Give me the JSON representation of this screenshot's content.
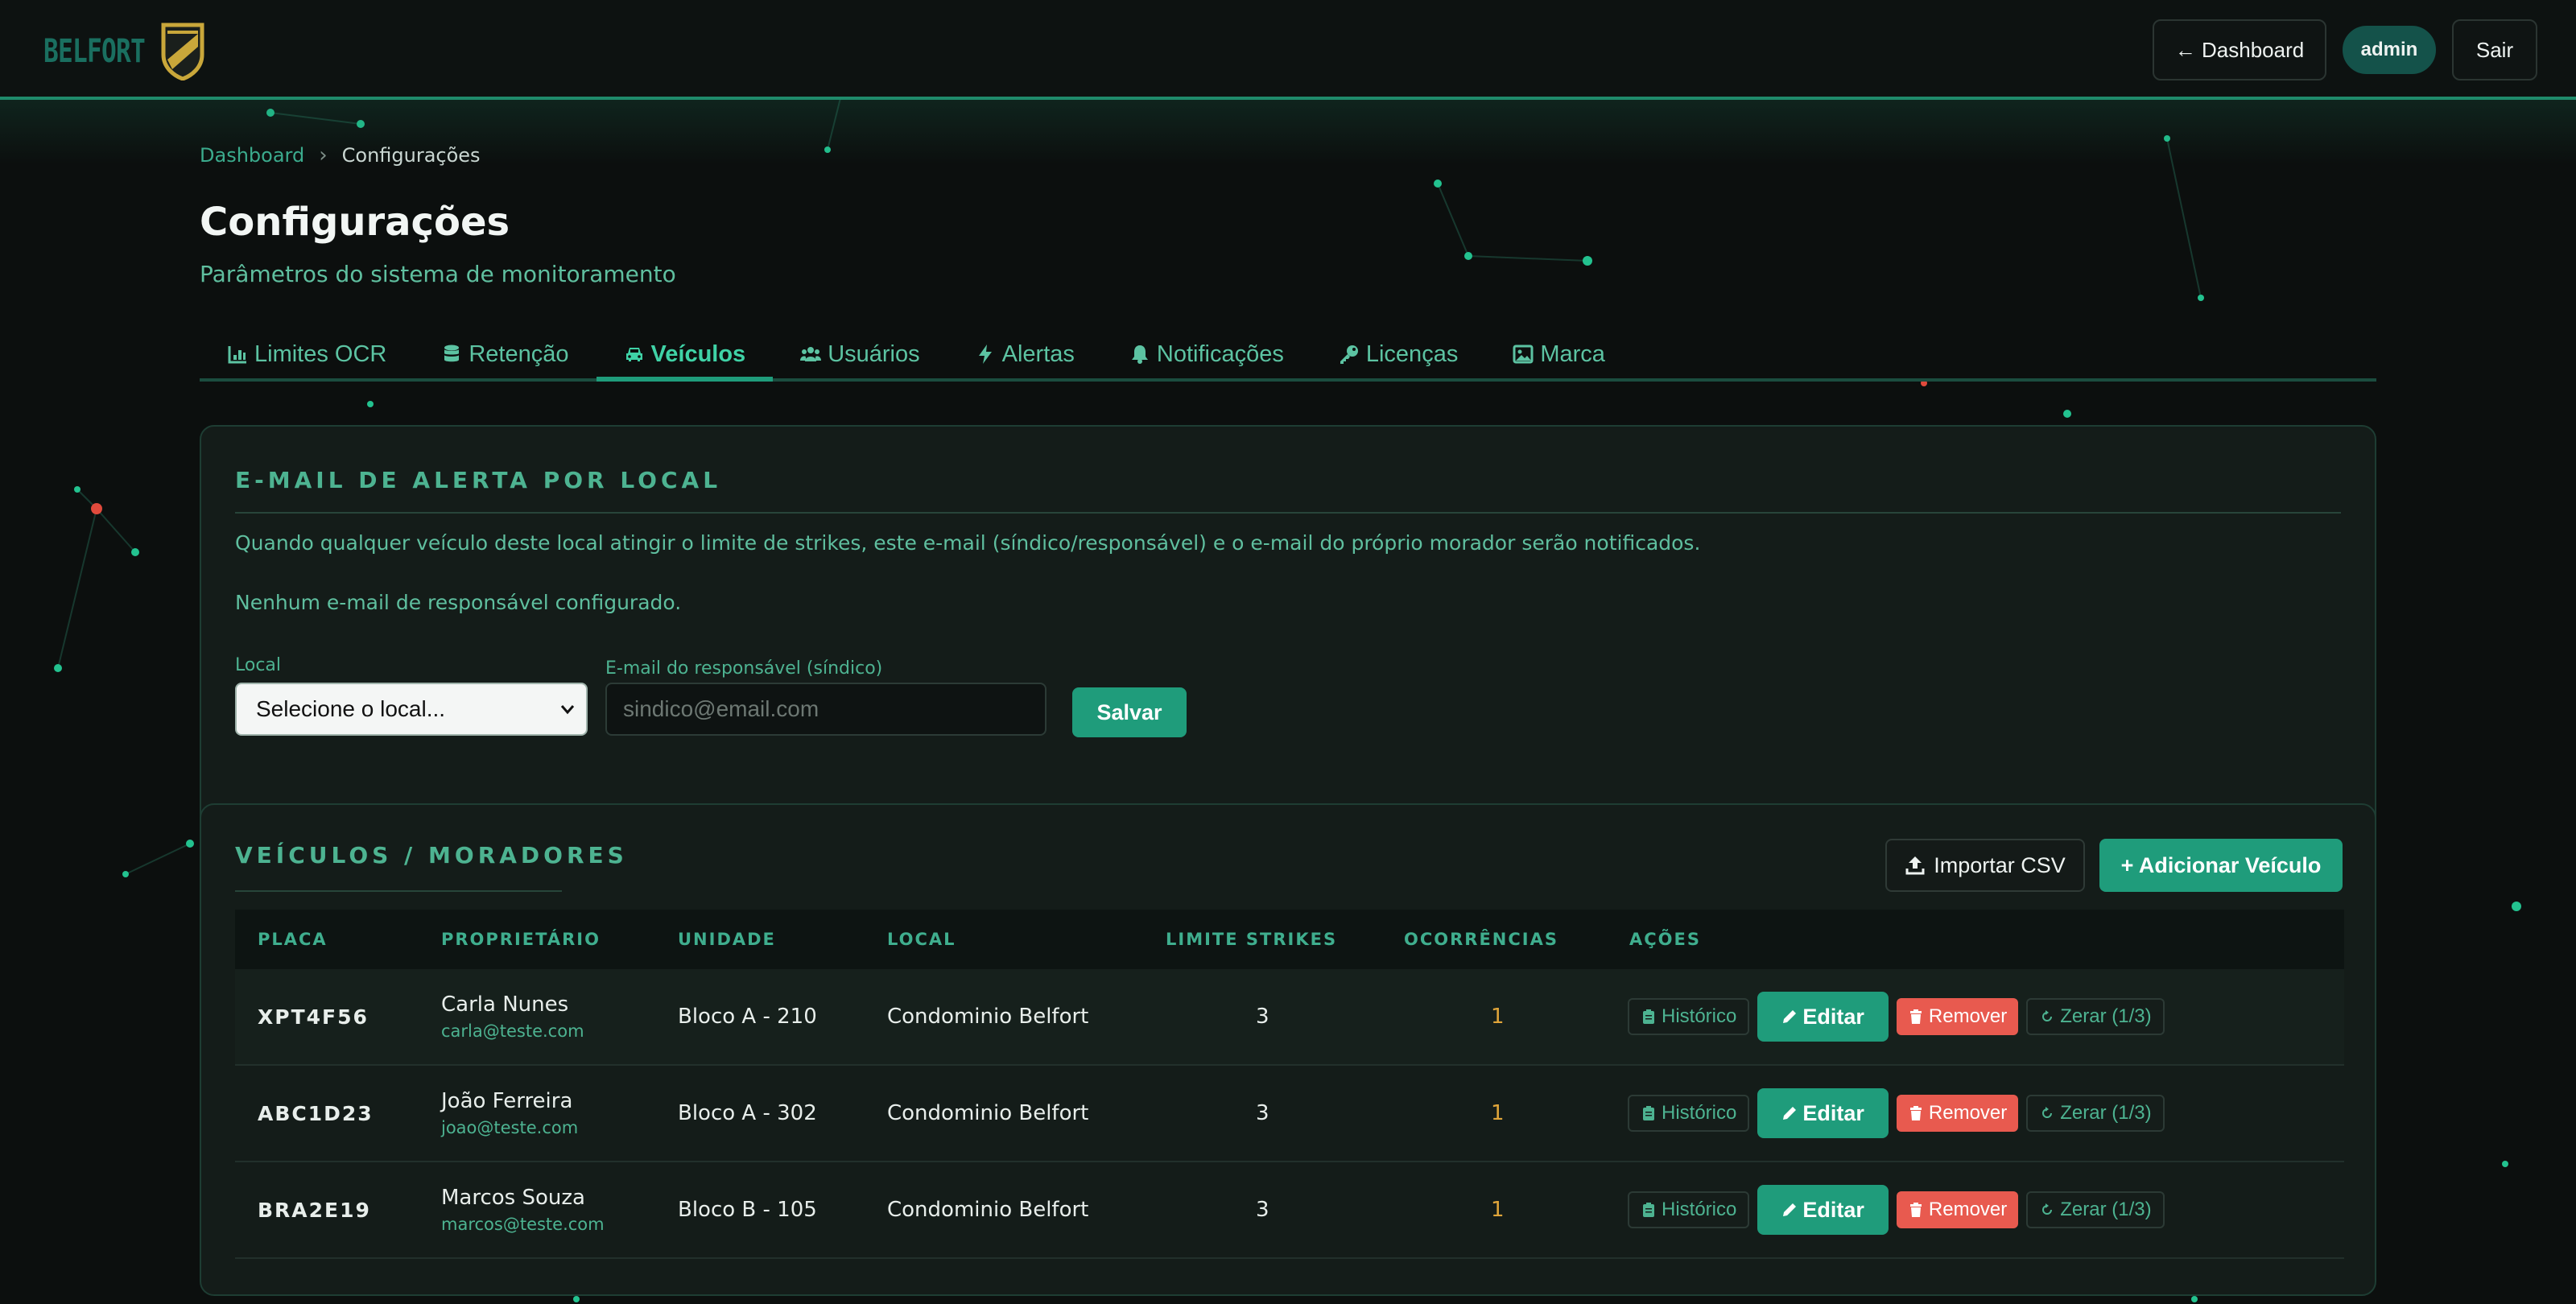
{
  "header": {
    "logo_text": "BELFORT",
    "dashboard_button": "← Dashboard",
    "user_badge": "admin",
    "logout_button": "Sair"
  },
  "breadcrumb": {
    "root": "Dashboard",
    "current": "Configurações"
  },
  "page": {
    "title": "Configurações",
    "subtitle": "Parâmetros do sistema de monitoramento"
  },
  "tabs": [
    {
      "label": "Limites OCR",
      "icon": "chart-icon"
    },
    {
      "label": "Retenção",
      "icon": "database-icon"
    },
    {
      "label": "Veículos",
      "icon": "car-icon",
      "active": true
    },
    {
      "label": "Usuários",
      "icon": "users-icon"
    },
    {
      "label": "Alertas",
      "icon": "bolt-icon"
    },
    {
      "label": "Notificações",
      "icon": "bell-icon"
    },
    {
      "label": "Licenças",
      "icon": "key-icon"
    },
    {
      "label": "Marca",
      "icon": "image-icon"
    }
  ],
  "alert_email": {
    "title": "E-MAIL DE ALERTA POR LOCAL",
    "description": "Quando qualquer veículo deste local atingir o limite de strikes, este e-mail (síndico/responsável) e o e-mail do próprio morador serão notificados.",
    "none_configured": "Nenhum e-mail de responsável configurado.",
    "local_label": "Local",
    "local_value": "Selecione o local...",
    "email_label": "E-mail do responsável (síndico)",
    "email_placeholder": "sindico@email.com",
    "save_button": "Salvar"
  },
  "vehicles": {
    "title": "VEÍCULOS / MORADORES",
    "import_button": "Importar CSV",
    "add_button": "+ Adicionar Veículo",
    "columns": [
      "PLACA",
      "PROPRIETÁRIO",
      "UNIDADE",
      "LOCAL",
      "LIMITE STRIKES",
      "OCORRÊNCIAS",
      "AÇÕES"
    ],
    "actions": {
      "history": "Histórico",
      "edit": "Editar",
      "remove": "Remover",
      "reset": "Zerar (1/3)"
    },
    "rows": [
      {
        "plate": "XPT4F56",
        "owner": "Carla Nunes",
        "email": "carla@teste.com",
        "unit": "Bloco A - 210",
        "local": "Condominio Belfort",
        "limit": "3",
        "occurrences": "1"
      },
      {
        "plate": "ABC1D23",
        "owner": "João Ferreira",
        "email": "joao@teste.com",
        "unit": "Bloco A - 302",
        "local": "Condominio Belfort",
        "limit": "3",
        "occurrences": "1"
      },
      {
        "plate": "BRA2E19",
        "owner": "Marcos Souza",
        "email": "marcos@teste.com",
        "unit": "Bloco B - 105",
        "local": "Condominio Belfort",
        "limit": "3",
        "occurrences": "1"
      }
    ]
  },
  "colors": {
    "accent": "#1f9c7b",
    "accent_text": "#4db391",
    "danger": "#e85a4f",
    "warning": "#e0a53a",
    "background": "#0c0f0e"
  }
}
